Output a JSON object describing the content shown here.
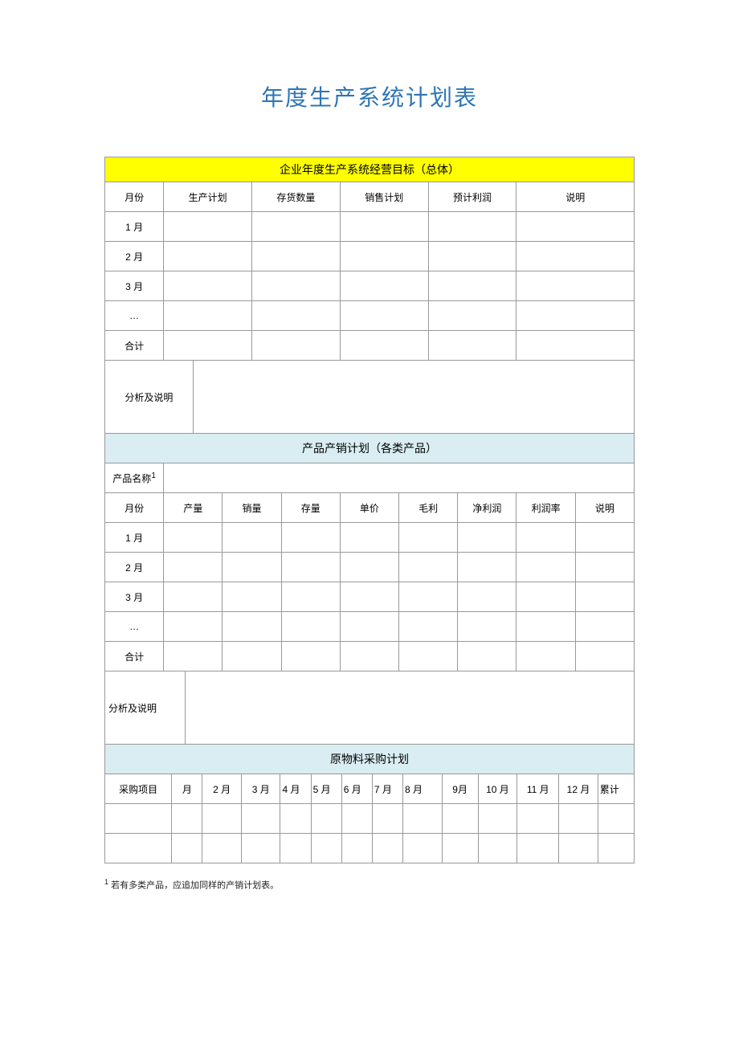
{
  "title": "年度生产系统计划表",
  "section1": {
    "header": "企业年度生产系统经营目标（总体）",
    "cols": [
      "月份",
      "生产计划",
      "存货数量",
      "销售计划",
      "预计利润",
      "说明"
    ],
    "rows": [
      "1 月",
      "2 月",
      "3 月",
      "…",
      "合计"
    ],
    "analysis_label": "分析及说明"
  },
  "section2": {
    "header": "产品产销计划（各类产品）",
    "product_label": "产品名称",
    "product_sup": "1",
    "cols": [
      "月份",
      "产量",
      "销量",
      "存量",
      "单价",
      "毛利",
      "净利润",
      "利润率",
      "说明"
    ],
    "rows": [
      "1 月",
      "2 月",
      "3 月",
      "…",
      "合计"
    ],
    "analysis_label": "分析及说明"
  },
  "section3": {
    "header": "原物料采购计划",
    "cols": [
      "采购项目",
      "月",
      "2 月",
      "3 月",
      "4 月",
      "5 月",
      "6 月",
      "7 月",
      "8 月",
      "9月",
      "10 月",
      "11 月",
      "12 月",
      "累计"
    ]
  },
  "footnote": {
    "sup": "1",
    "text": " 若有多类产品，应追加同样的产销计划表。"
  }
}
